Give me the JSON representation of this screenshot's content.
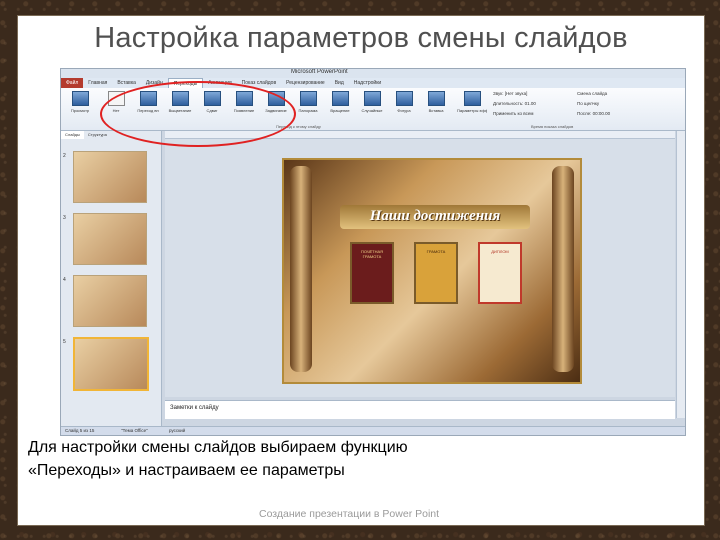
{
  "slide_title": "Настройка параметров смены слайдов",
  "window": {
    "title": "Microsoft PowerPoint"
  },
  "tabs": [
    {
      "label": "Файл",
      "state": "file"
    },
    {
      "label": "Главная",
      "state": ""
    },
    {
      "label": "Вставка",
      "state": ""
    },
    {
      "label": "Дизайн",
      "state": ""
    },
    {
      "label": "Переходы",
      "state": "active"
    },
    {
      "label": "Анимация",
      "state": ""
    },
    {
      "label": "Показ слайдов",
      "state": ""
    },
    {
      "label": "Рецензирование",
      "state": ""
    },
    {
      "label": "Вид",
      "state": ""
    },
    {
      "label": "Надстройки",
      "state": ""
    }
  ],
  "ribbon": {
    "preview_label": "Просмотр",
    "transitions": [
      "Нет",
      "Переход вн",
      "Выцветание",
      "Сдвиг",
      "Появление",
      "Задвигание",
      "Панорама",
      "Вращение",
      "Случайные",
      "Фигура",
      "Вставка"
    ],
    "group_transition": "Переход к этому слайду",
    "group_timing": "Время показа слайдов",
    "effect_params": "Параметры эффектов",
    "sound": "Звук: [Нет звука]",
    "duration": "Длительность: 01.00",
    "apply_all": "Применить ко всем",
    "advance_heading": "Смена слайда",
    "on_click": "По щелчку",
    "after": "После: 00:00.00"
  },
  "thumbs_panel": {
    "tab_slides": "Слайды",
    "tab_outline": "Структура",
    "numbers": [
      "2",
      "3",
      "4",
      "5"
    ]
  },
  "main_slide": {
    "heading": "Наши достижения",
    "cert_labels": [
      "ПОЧЁТНАЯ ГРАМОТА",
      "ГРАМОТА",
      "ДИПЛОМ"
    ]
  },
  "notes": {
    "placeholder": "Заметки к слайду"
  },
  "status": {
    "slide_num": "Слайд 5 из 15",
    "theme": "\"Тема Office\"",
    "lang": "русский"
  },
  "description": "Для настройки смены слайдов выбираем функцию «Переходы» и настраиваем ее параметры",
  "footer": "Создание презентации в Power Point",
  "colors": {
    "highlight_oval": "#e02222",
    "file_tab": "#b43b2e"
  }
}
